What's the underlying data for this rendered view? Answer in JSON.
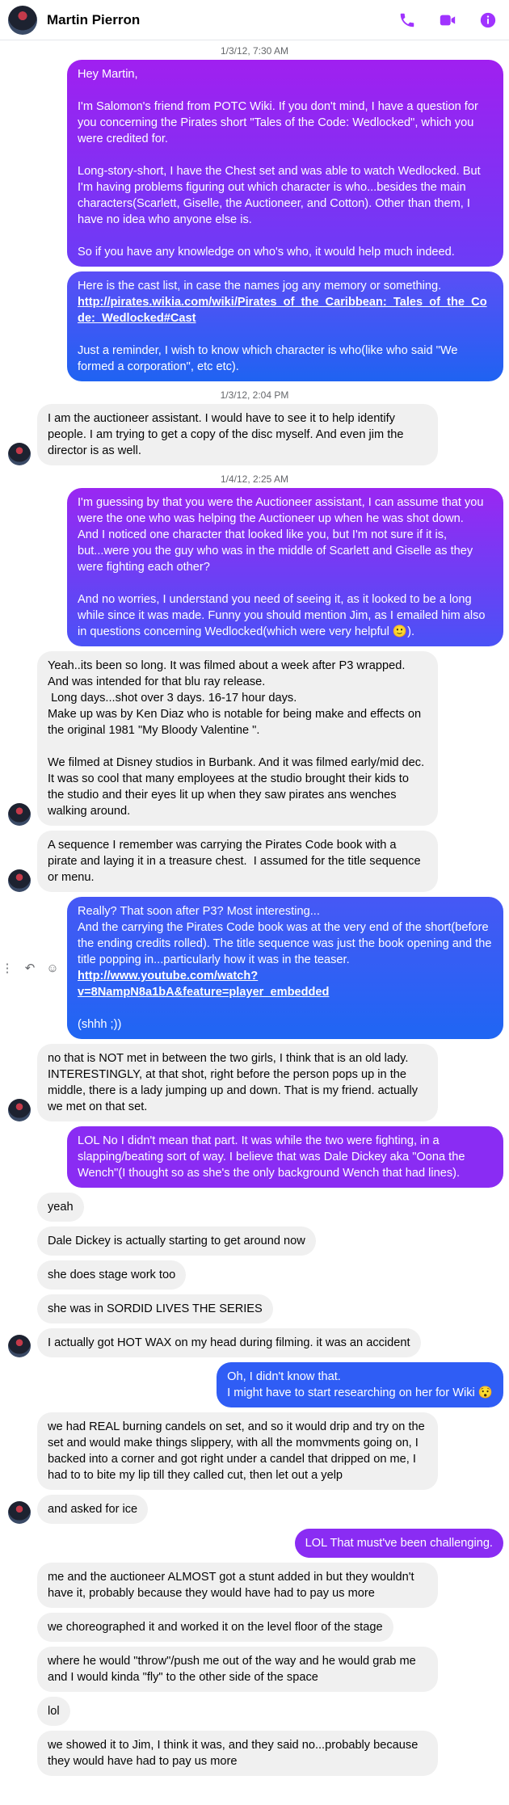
{
  "header": {
    "contact_name": "Martin Pierron",
    "accent_color": "#a033ff",
    "icons": [
      "phone-icon",
      "video-call-icon",
      "info-icon"
    ]
  },
  "timestamps": [
    "1/3/12, 7:30 AM",
    "1/3/12, 2:04 PM",
    "1/4/12, 2:25 AM"
  ],
  "messages": {
    "m1": "Hey Martin,\n\nI'm Salomon's friend from POTC Wiki. If you don't mind, I have a question for you concerning the Pirates short \"Tales of the Code: Wedlocked\", which you were credited for.\n\nLong-story-short, I have the Chest set and was able to watch Wedlocked. But I'm having problems figuring out which character is who...besides the main characters(Scarlett, Giselle, the Auctioneer, and Cotton). Other than them, I have no idea who anyone else is.\n\nSo if you have any knowledge on who's who, it would help much indeed.",
    "m2_a": "Here is the cast list, in case the names jog any memory or something.",
    "m2_link": "http://pirates.wikia.com/wiki/Pirates_of_the_Caribbean:_Tales_of_the_Code:_Wedlocked#Cast",
    "m2_b": "Just a reminder, I wish to know which character is who(like who said \"We formed a corporation\", etc etc).",
    "m3": "I am the auctioneer assistant. I would have to see it to help identify people. I am trying to get a copy of the disc myself. And even jim the director is as well.",
    "m4": "I'm guessing by that you were the Auctioneer assistant, I can assume that you were the one who was helping the Auctioneer up when he was shot down.\nAnd I noticed one character that looked like you, but I'm not sure if it is, but...were you the guy who was in the middle of Scarlett and Giselle as they were fighting each other?\n\nAnd no worries, I understand you need of seeing it, as it looked to be a long while since it was made. Funny you should mention Jim, as I emailed him also in questions concerning Wedlocked(which were very helpful 🙂).",
    "m5": "Yeah..its been so long. It was filmed about a week after P3 wrapped. And was intended for that blu ray release.\n Long days...shot over 3 days. 16-17 hour days.\nMake up was by Ken Diaz who is notable for being make and effects on the original 1981 \"My Bloody Valentine \".\n\nWe filmed at Disney studios in Burbank. And it was filmed early/mid dec. It was so cool that many employees at the studio brought their kids to the studio and their eyes lit up when they saw pirates ans wenches walking around.",
    "m6": "A sequence I remember was carrying the Pirates Code book with a pirate and laying it in a treasure chest.  I assumed for the title sequence or menu.",
    "m7_a": "Really? That soon after P3? Most interesting...\nAnd the carrying the Pirates Code book was at the very end of the short(before the ending credits rolled). The title sequence was just the book opening and the title popping in...particularly how it was in the teaser.",
    "m7_link": "http://www.youtube.com/watch?v=8NampN8a1bA&feature=player_embedded",
    "m7_b": "(shhh ;))",
    "m8": "no that is NOT met in between the two girls, I think that is an old lady. INTERESTINGLY, at that shot, right before the person pops up in the middle, there is a lady jumping up and down. That is my friend. actually we met on that set.",
    "m9": "LOL No I didn't mean that part. It was while the two were fighting, in a slapping/beating sort of way. I believe that was Dale Dickey aka \"Oona the Wench\"(I thought so as she's the only background Wench that had lines).",
    "m10": "yeah",
    "m11": "Dale Dickey is actually starting to get around now",
    "m12": "she does stage work too",
    "m13": "she was in SORDID LIVES THE SERIES",
    "m14": "I actually got HOT WAX on my head during filming. it was an accident",
    "m15": "Oh, I didn't know that.\nI might have to start researching on her for Wiki 😯",
    "m16": "we had REAL burning candels on set, and so it would drip and try on the set and would make things slippery, with all the momvments going on, I backed into a corner and got right under a candel that dripped on me, I had to to bite my lip till they called cut, then let out a yelp",
    "m17": "and asked for ice",
    "m18": "LOL That must've been challenging.",
    "m19": "me and the auctioneer ALMOST got a stunt added in but they wouldn't have it, probably because they would have had to pay us more",
    "m20": "we choreographed it and worked it on the level floor of the stage",
    "m21": "where he would \"throw\"/push me out of the way and he would grab me and I would kinda \"fly\" to the other side of the space",
    "m22": "lol",
    "m23": "we showed it to Jim, I think it was, and they said no...probably because they would have had to pay us more"
  },
  "message_actions": [
    "more-options-icon",
    "reply-icon",
    "react-icon"
  ]
}
